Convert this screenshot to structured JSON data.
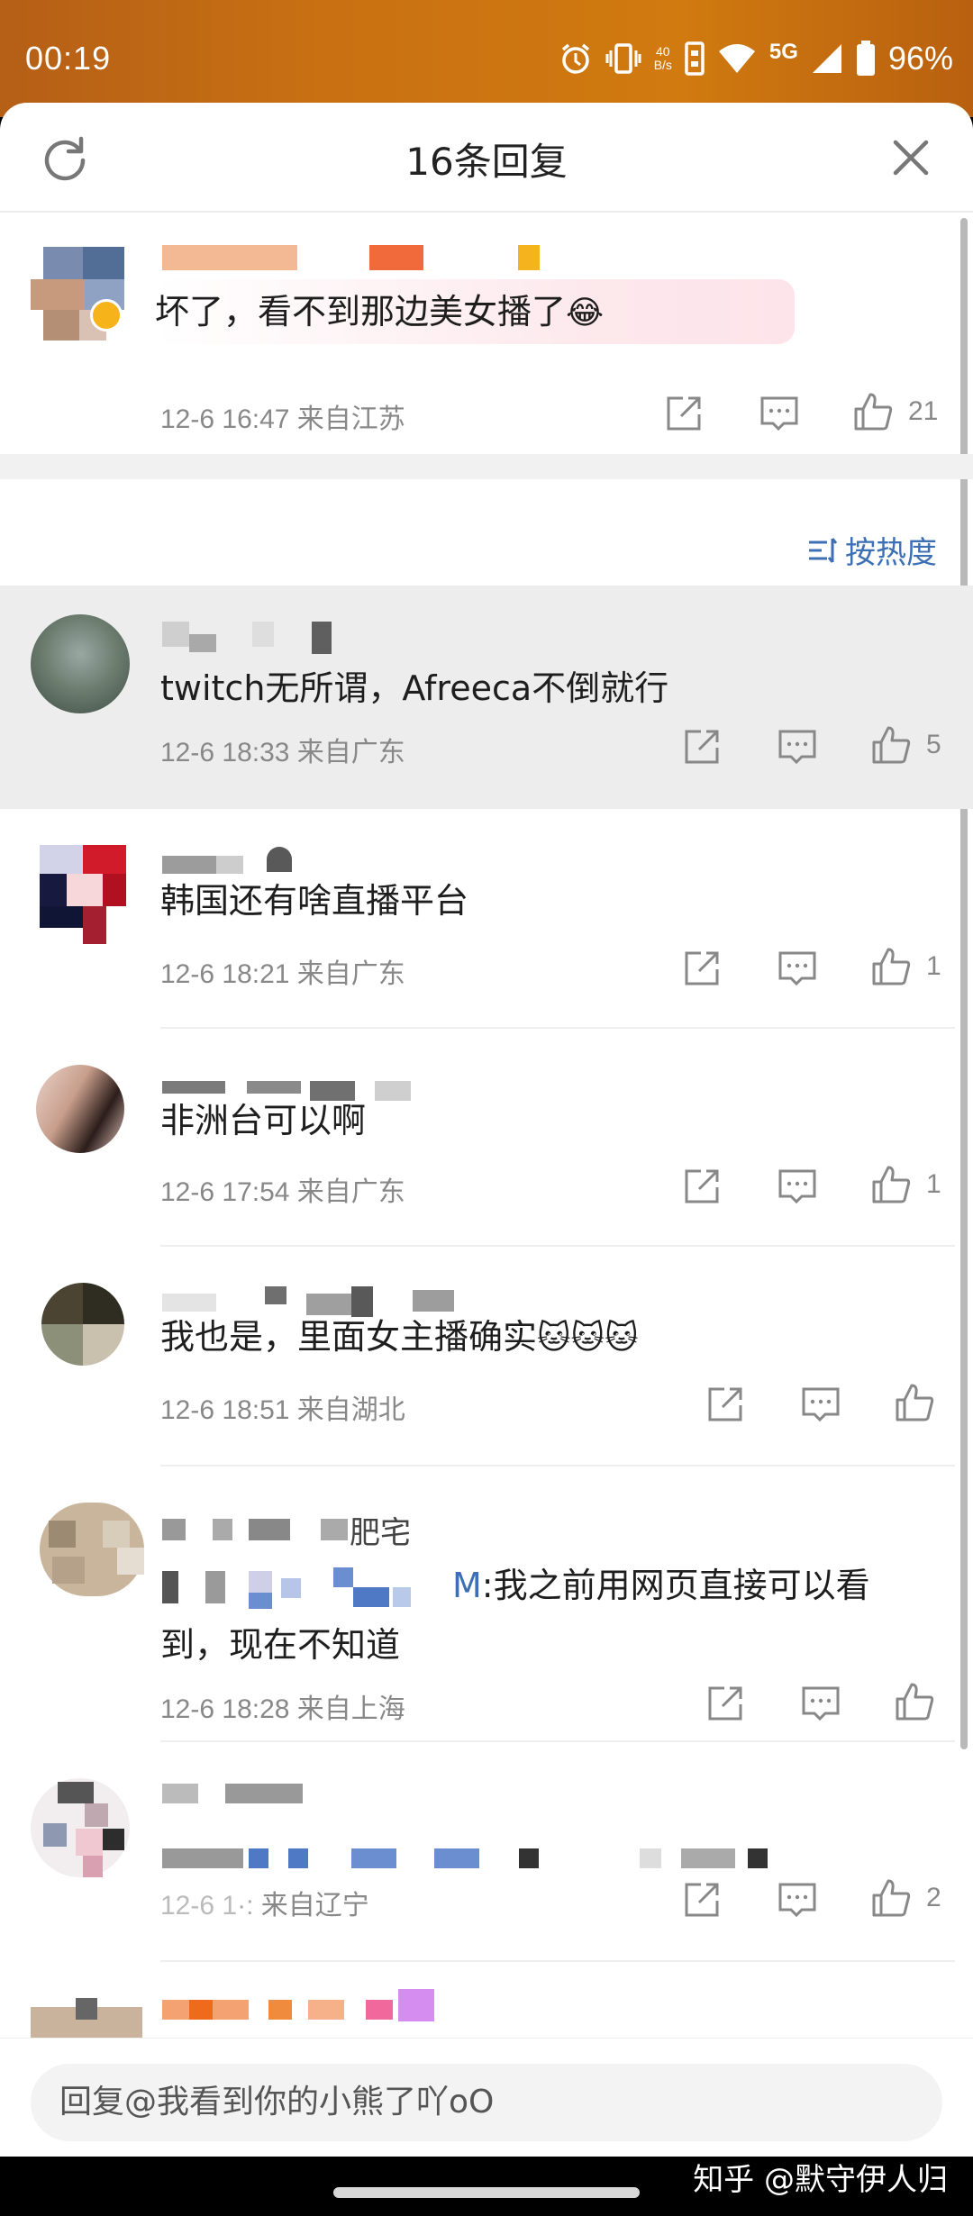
{
  "status_bar": {
    "time": "00:19",
    "netspeed_value": "40",
    "netspeed_unit": "B/s",
    "network": "5G",
    "battery": "96%"
  },
  "sheet": {
    "title": "16条回复"
  },
  "top_comment": {
    "text": "坏了，看不到那边美女播了",
    "emoji": "😂",
    "meta": "12-6 16:47  来自江苏",
    "likes": "21"
  },
  "sort": {
    "label": "按热度"
  },
  "replies": [
    {
      "text": "twitch无所谓，Afreeca不倒就行",
      "meta": "12-6 18:33  来自广东",
      "likes": "5"
    },
    {
      "text": "韩国还有啥直播平台",
      "meta": "12-6 18:21  来自广东",
      "likes": "1"
    },
    {
      "text": "非洲台可以啊",
      "meta": "12-6 17:54  来自广东",
      "likes": "1"
    },
    {
      "text": "我也是，里面女主播确实",
      "emoji": "🐱🐱🐱",
      "meta": "12-6 18:51  来自湖北",
      "likes": ""
    },
    {
      "name_fragment": "肥宅",
      "text_line1_prefix": "M",
      "text_line1": ":我之前用网页直接可以看",
      "text_line2": "到，现在不知道",
      "meta": "12-6 18:28  来自上海",
      "likes": ""
    },
    {
      "meta": "来自辽宁",
      "likes": "2"
    }
  ],
  "reply_input": {
    "placeholder": "回复@我看到你的小熊了吖oO"
  },
  "watermark": "知乎 @默守伊人归",
  "colors": {
    "accent_blue": "#3c6fb4",
    "status_bar": "#c97112",
    "meta_gray": "#888888"
  }
}
